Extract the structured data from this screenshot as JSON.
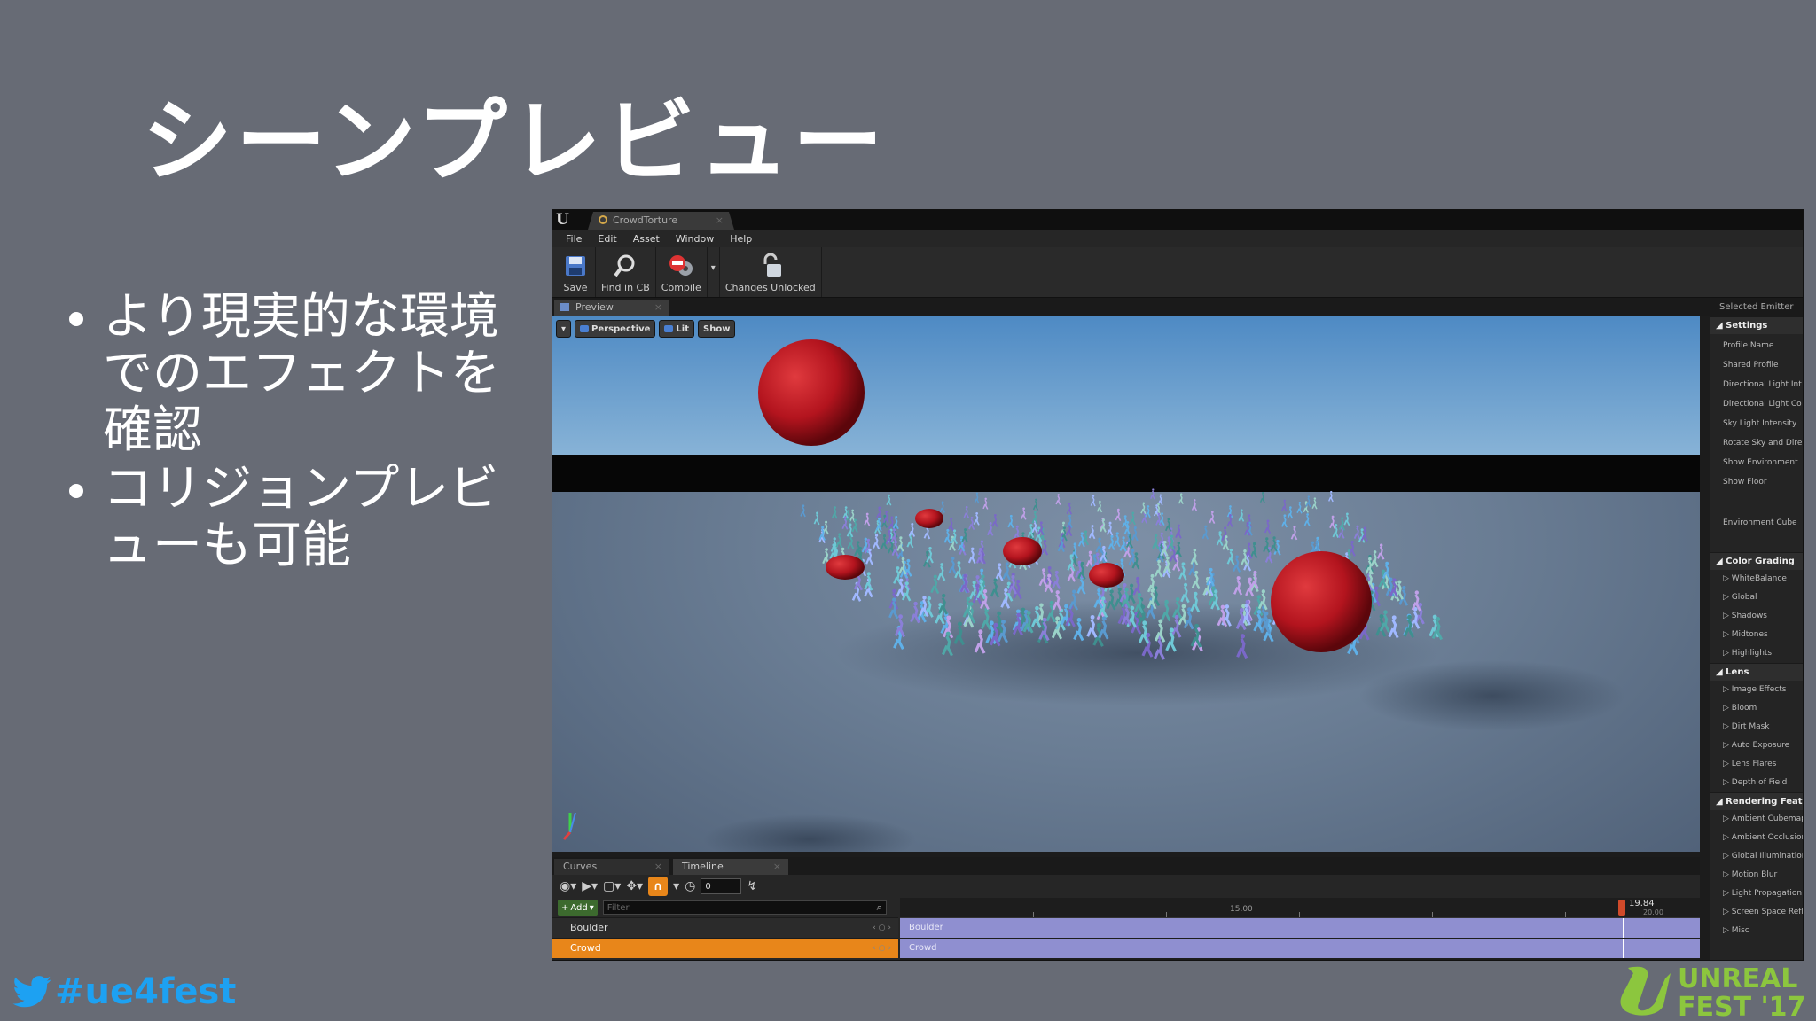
{
  "slide": {
    "title": "シーンプレビュー",
    "bullets": [
      "より現実的な環境でのエフェクトを確認",
      "コリジョンプレビューも可能"
    ],
    "hashtag": "#ue4fest",
    "logo_text": [
      "UNREAL",
      "FEST '17"
    ]
  },
  "editor": {
    "app_logo": "U",
    "document_tab": "CrowdTorture",
    "menu": [
      "File",
      "Edit",
      "Asset",
      "Window",
      "Help"
    ],
    "toolbar": {
      "save": "Save",
      "find_in_cb": "Find in CB",
      "compile": "Compile",
      "changes_unlocked": "Changes Unlocked"
    },
    "preview_tab": "Preview",
    "viewport": {
      "perspective": "Perspective",
      "lit": "Lit",
      "show": "Show"
    },
    "right_panel": {
      "header": "Selected Emitter",
      "settings": {
        "label": "Settings",
        "items": [
          "Profile Name",
          "Shared Profile",
          "Directional Light Int",
          "Directional Light Co",
          "Sky Light Intensity",
          "Rotate Sky and Dire",
          "Show Environment",
          "Show Floor",
          "Environment Cube"
        ]
      },
      "color_grading": {
        "label": "Color Grading",
        "items": [
          "WhiteBalance",
          "Global",
          "Shadows",
          "Midtones",
          "Highlights"
        ]
      },
      "lens": {
        "label": "Lens",
        "items": [
          "Image Effects",
          "Bloom",
          "Dirt Mask",
          "Auto Exposure",
          "Lens Flares",
          "Depth of Field"
        ]
      },
      "rendering": {
        "label": "Rendering Featur",
        "items": [
          "Ambient Cubemap",
          "Ambient Occlusion",
          "Global Illumination",
          "Motion Blur",
          "Light Propagation V",
          "Screen Space Refle",
          "Misc"
        ]
      }
    },
    "bottom": {
      "tabs": [
        "Curves",
        "Timeline"
      ],
      "time_value": "0",
      "add_label": "Add",
      "filter_placeholder": "Filter",
      "tracks": [
        "Boulder",
        "Crowd"
      ],
      "ruler_mark": "15.00",
      "playhead": "19.84",
      "playhead_sub": "20.00",
      "bars": [
        "Boulder",
        "Crowd"
      ]
    }
  },
  "colors": {
    "slide_bg": "#676b75",
    "twitter_blue": "#1da1f2",
    "logo_green": "#8cc63e",
    "accent_orange": "#e8861a",
    "timeline_bar": "#8f8fd0",
    "sphere_red": "#b3141e"
  }
}
